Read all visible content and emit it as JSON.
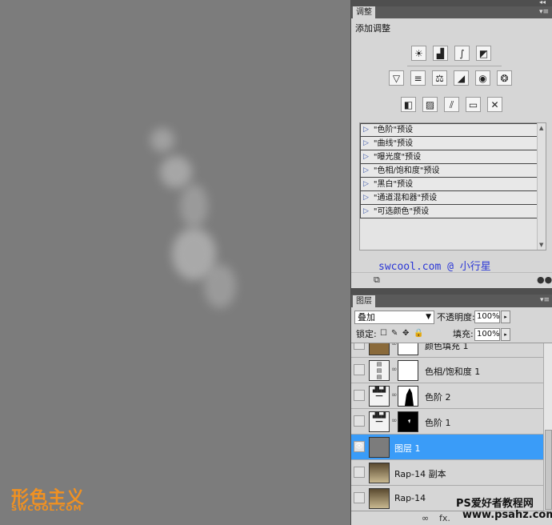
{
  "canvas": {
    "logo_main": "形色主义",
    "logo_sub": "SWCOOL.COM"
  },
  "adjust_panel": {
    "tab": "调整",
    "title": "添加调整",
    "row1_icons": [
      "brightness-contrast-icon",
      "levels-icon",
      "curves-icon",
      "exposure-icon"
    ],
    "row2_icons": [
      "vibrance-icon",
      "hue-saturation-icon",
      "color-balance-icon",
      "black-white-icon",
      "photo-filter-icon",
      "channel-mixer-icon"
    ],
    "row3_icons": [
      "invert-icon",
      "posterize-icon",
      "threshold-icon",
      "gradient-map-icon",
      "selective-color-icon"
    ],
    "presets": [
      "\"色阶\"预设",
      "\"曲线\"预设",
      "\"曝光度\"预设",
      "\"色相/饱和度\"预设",
      "\"黑白\"预设",
      "\"通道混和器\"预设",
      "\"可选颜色\"预设"
    ],
    "watermark": "swcool.com  @  小行星"
  },
  "layers_panel": {
    "tab": "图层",
    "blend_mode": "叠加",
    "opacity_label": "不透明度:",
    "opacity_value": "100%",
    "lock_label": "锁定:",
    "fill_label": "填充:",
    "fill_value": "100%",
    "layers": [
      {
        "name": "颜色填充 1",
        "visible": false,
        "selected": false
      },
      {
        "name": "色相/饱和度 1",
        "visible": false,
        "selected": false
      },
      {
        "name": "色阶 2",
        "visible": false,
        "selected": false
      },
      {
        "name": "色阶 1",
        "visible": false,
        "selected": false
      },
      {
        "name": "图层 1",
        "visible": true,
        "selected": true
      },
      {
        "name": "Rap-14 副本",
        "visible": false,
        "selected": false
      },
      {
        "name": "Rap-14",
        "visible": false,
        "selected": false
      }
    ],
    "footer_fx": "fx."
  },
  "watermarks": {
    "line1": "PS爱好者教程网",
    "line2": "www.psahz.com"
  },
  "colors": {
    "selection": "#3a9cf8",
    "canvas": "#7c7c7c",
    "panel": "#d6d6d6",
    "logo": "#f19121",
    "watermark_blue": "#2a36d6"
  }
}
